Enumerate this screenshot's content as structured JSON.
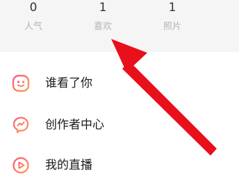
{
  "stats": [
    {
      "count": "0",
      "label": "人气"
    },
    {
      "count": "1",
      "label": "喜欢"
    },
    {
      "count": "1",
      "label": "照片"
    }
  ],
  "menu": [
    {
      "label": "谁看了你",
      "icon": "smiley-face-icon"
    },
    {
      "label": "创作者中心",
      "icon": "creator-center-icon"
    },
    {
      "label": "我的直播",
      "icon": "live-play-icon"
    }
  ],
  "colors": {
    "stats_background": "#f5f5f5",
    "icon_gradient_start": "#ff5a7e",
    "icon_gradient_end": "#ff9a4e",
    "annotation_arrow": "#e8101a"
  }
}
